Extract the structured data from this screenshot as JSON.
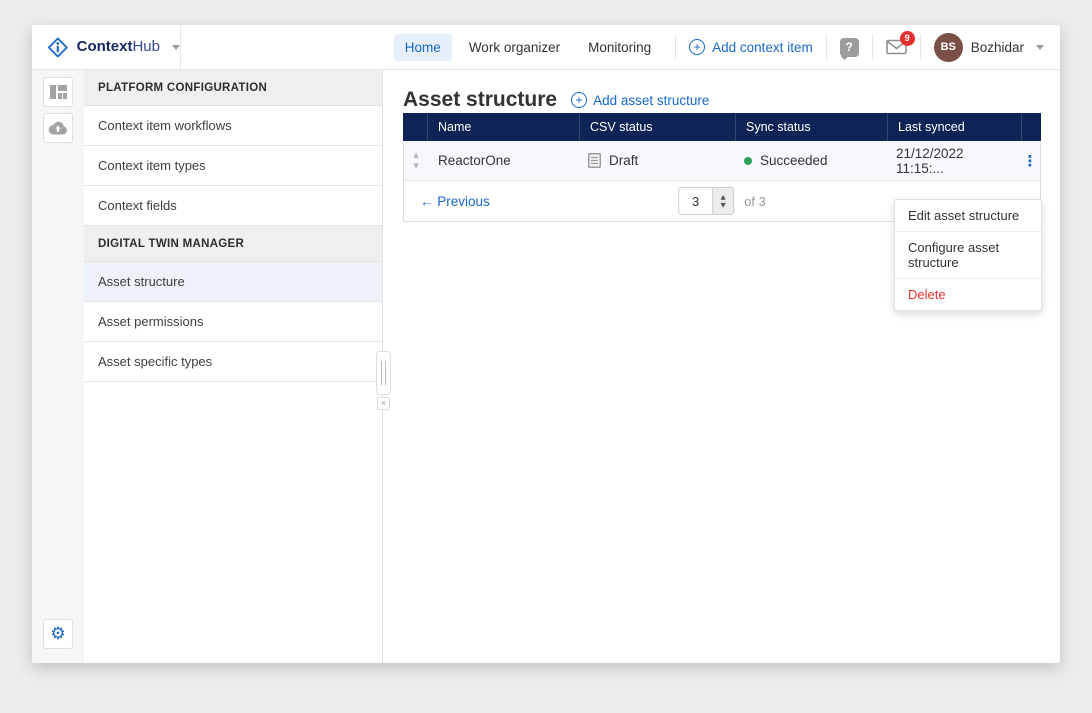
{
  "topbar": {
    "brand": {
      "bold": "Context",
      "light": "Hub"
    },
    "tabs": [
      {
        "label": "Home"
      },
      {
        "label": "Work organizer"
      },
      {
        "label": "Monitoring"
      }
    ],
    "add_label": "Add context item",
    "notification_count": "9",
    "user": {
      "initials": "BS",
      "name": "Bozhidar"
    }
  },
  "sidebar": {
    "sections": [
      {
        "header": "PLATFORM CONFIGURATION",
        "items": [
          {
            "label": "Context item workflows"
          },
          {
            "label": "Context item types"
          },
          {
            "label": "Context fields"
          }
        ]
      },
      {
        "header": "DIGITAL TWIN MANAGER",
        "items": [
          {
            "label": "Asset structure"
          },
          {
            "label": "Asset permissions"
          },
          {
            "label": "Asset specific types"
          }
        ]
      }
    ]
  },
  "main": {
    "title": "Asset structure",
    "add_link": "Add asset structure",
    "table": {
      "columns": [
        "Name",
        "CSV status",
        "Sync status",
        "Last synced"
      ],
      "rows": [
        {
          "name": "ReactorOne",
          "csv_status": "Draft",
          "sync_status": "Succeeded",
          "last_synced": "21/12/2022 11:15:..."
        }
      ]
    },
    "pagination": {
      "previous": "← Previous",
      "page": "3",
      "of_label": "of 3"
    }
  },
  "context_menu": {
    "items": [
      {
        "label": "Edit asset structure"
      },
      {
        "label": "Configure asset structure"
      },
      {
        "label": "Delete"
      }
    ]
  },
  "icons": {
    "plus": "+",
    "question": "?",
    "kebab": "⋮",
    "gear": "⚙",
    "sort_up": "▲",
    "sort_down": "▼",
    "spin_up": "▲",
    "spin_down": "▼",
    "close": "×"
  },
  "colors": {
    "accent_blue": "#1668c9",
    "table_header_navy": "#0f2456",
    "success_green": "#2fa05a",
    "danger_red": "#e5322d",
    "badge_red": "#e62e2e",
    "avatar_brown": "#7a5046",
    "active_tab_bg": "#e7effb"
  }
}
